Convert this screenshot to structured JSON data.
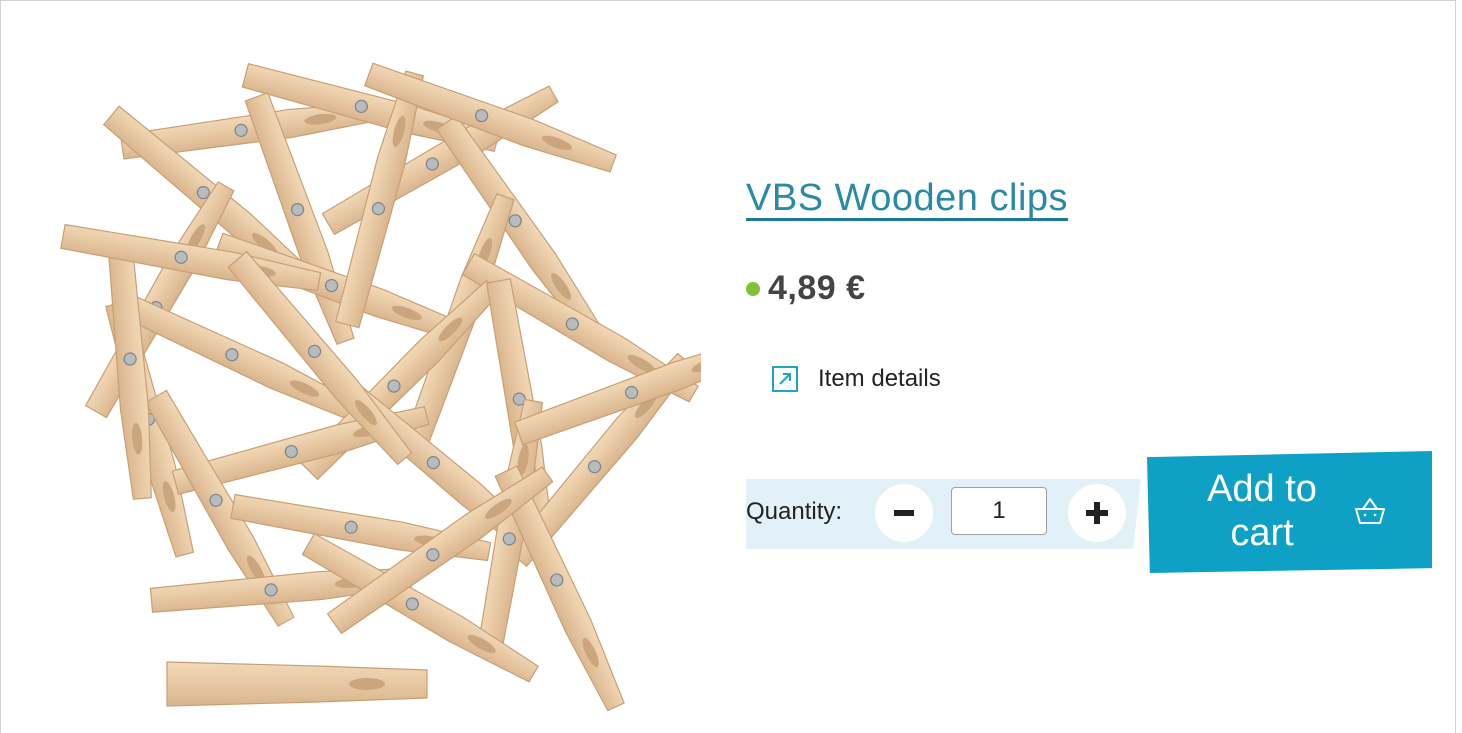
{
  "product": {
    "title": "VBS Wooden clips",
    "price": "4,89 €",
    "availability_color": "#7ec238",
    "image_alt": "wooden-clothespins-photo"
  },
  "details_link": {
    "label": "Item details",
    "icon": "external-arrow-icon"
  },
  "quantity": {
    "label": "Quantity:",
    "value": "1",
    "minus_icon": "minus-icon",
    "plus_icon": "plus-icon"
  },
  "cart": {
    "label": "Add to cart",
    "icon": "basket-icon",
    "color": "#0fa0c6"
  },
  "colors": {
    "accent": "#0fa0c6",
    "link": "#2a8aa6",
    "qty_bg": "#e1f1f7"
  }
}
